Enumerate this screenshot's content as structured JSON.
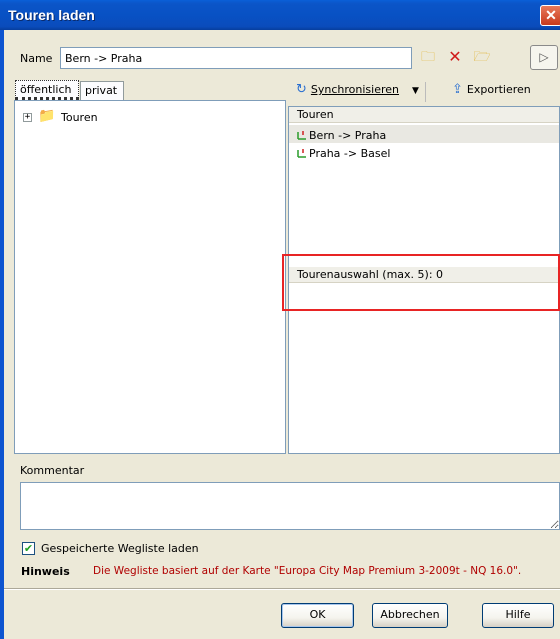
{
  "window": {
    "title": "Touren laden",
    "close_glyph": "✕"
  },
  "namebar": {
    "label": "Name",
    "value": "Bern -> Praha",
    "tools": [
      "new-folder-icon",
      "delete-icon",
      "open-folder-icon",
      "play-icon"
    ]
  },
  "tabs": [
    {
      "label": "öffentlich",
      "active": true
    },
    {
      "label": "privat",
      "active": false
    }
  ],
  "tree": {
    "root_label": "Touren",
    "expander": "+"
  },
  "toolbar": {
    "sync_label": "Synchronisieren",
    "export_label": "Exportieren"
  },
  "tours": {
    "header": "Touren",
    "items": [
      "Bern -> Praha",
      "Praha -> Basel"
    ],
    "selected_index": 0
  },
  "selection": {
    "header": "Tourenauswahl (max. 5):  0"
  },
  "comment": {
    "label": "Kommentar",
    "value": ""
  },
  "options": {
    "load_waylist_label": "Gespeicherte Wegliste laden",
    "load_waylist_checked": true
  },
  "hint": {
    "label": "Hinweis",
    "text": "Die Wegliste basiert auf der Karte \"Europa City Map Premium 3-2009t - NQ 16.0\"."
  },
  "buttons": {
    "ok": "OK",
    "cancel": "Abbrechen",
    "help": "Hilfe"
  },
  "colors": {
    "title_bar": "#0b55c8",
    "hint_text": "#b00000",
    "highlight": "#e82424"
  }
}
